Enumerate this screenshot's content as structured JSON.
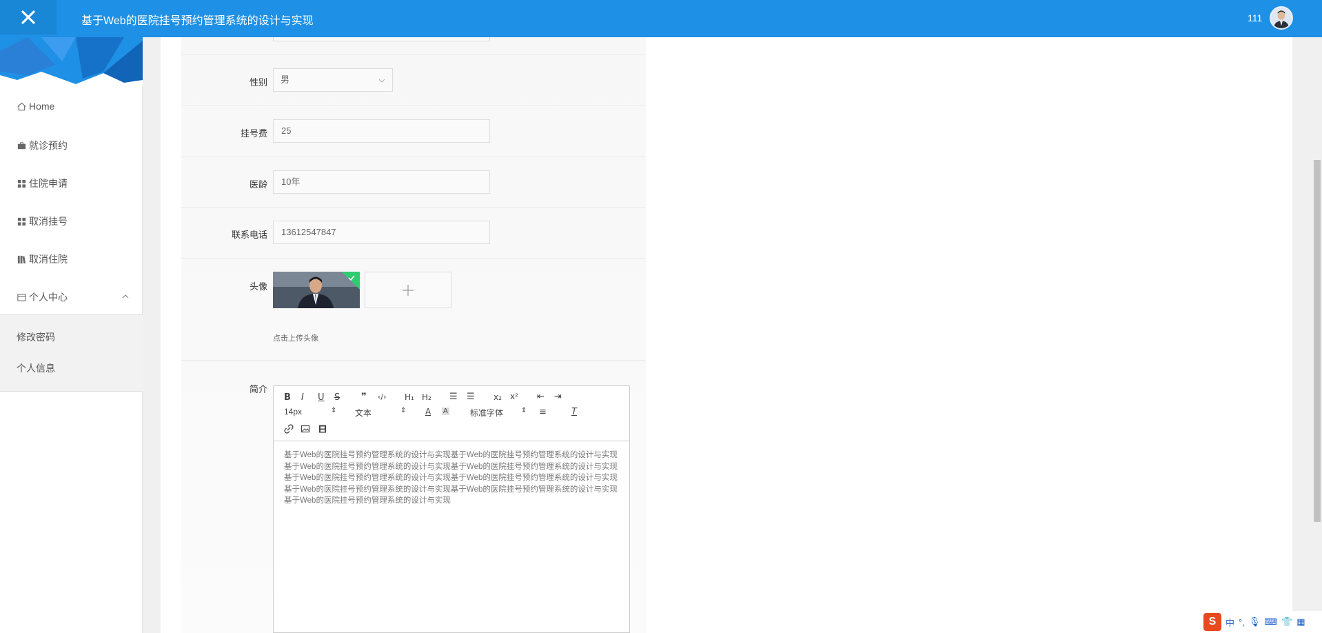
{
  "app": {
    "title": "基于Web的医院挂号预约管理系统的设计与实现",
    "user_name": "111"
  },
  "sidebar": {
    "items": [
      {
        "label": "Home",
        "icon": "home-icon"
      },
      {
        "label": "就诊预约",
        "icon": "briefcase-icon"
      },
      {
        "label": "住院申请",
        "icon": "grid-icon"
      },
      {
        "label": "取消挂号",
        "icon": "grid-icon"
      },
      {
        "label": "取消住院",
        "icon": "library-icon"
      },
      {
        "label": "个人中心",
        "icon": "card-icon"
      }
    ],
    "submenu": [
      {
        "label": "修改密码"
      },
      {
        "label": "个人信息"
      }
    ]
  },
  "form": {
    "gender": {
      "label": "性别",
      "value": "男"
    },
    "fee": {
      "label": "挂号费",
      "value": "25"
    },
    "experience": {
      "label": "医龄",
      "value": "10年"
    },
    "phone": {
      "label": "联系电话",
      "value": "13612547847"
    },
    "avatar": {
      "label": "头像",
      "hint": "点击上传头像"
    },
    "intro": {
      "label": "简介",
      "font_size": "14px",
      "text_format": "文本",
      "font_family": "标准字体",
      "content": "基于Web的医院挂号预约管理系统的设计与实现基于Web的医院挂号预约管理系统的设计与实现基于Web的医院挂号预约管理系统的设计与实现基于Web的医院挂号预约管理系统的设计与实现基于Web的医院挂号预约管理系统的设计与实现基于Web的医院挂号预约管理系统的设计与实现基于Web的医院挂号预约管理系统的设计与实现基于Web的医院挂号预约管理系统的设计与实现基于Web的医院挂号预约管理系统的设计与实现"
    }
  },
  "ime": {
    "lang": "中",
    "punct": "°,"
  },
  "colors": {
    "topbar": "#1e90e6",
    "accent_green": "#2ecc71"
  }
}
